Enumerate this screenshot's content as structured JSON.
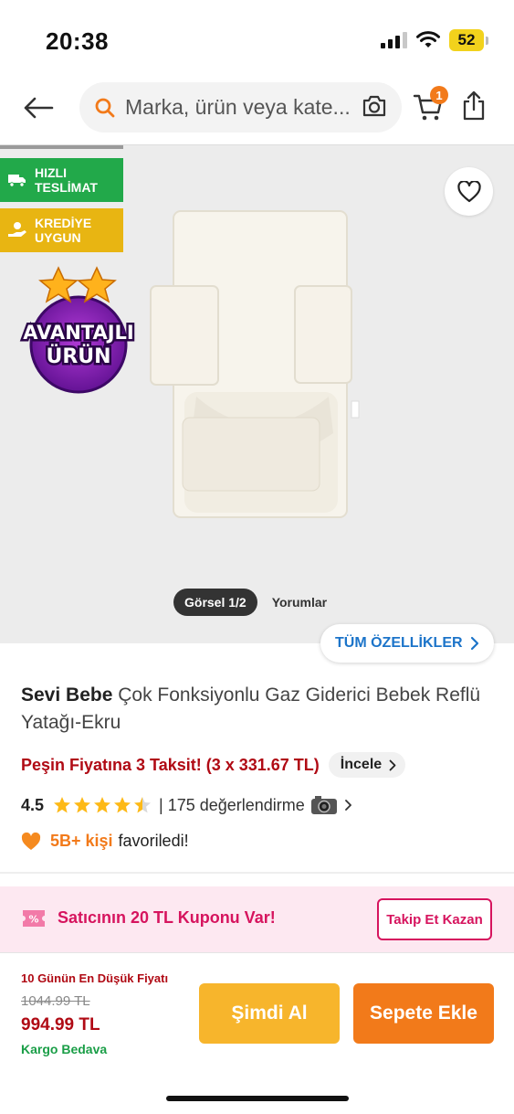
{
  "status_bar": {
    "time": "20:38",
    "battery": "52"
  },
  "search": {
    "placeholder": "Marka, ürün veya kate..."
  },
  "cart": {
    "badge": "1"
  },
  "gallery": {
    "tags": [
      {
        "label": "HIZLI TESLİMAT",
        "color": "#22a94a",
        "icon": "truck-icon"
      },
      {
        "label": "KREDİYE UYGUN",
        "color": "#e8b512",
        "icon": "coin-hand-icon"
      }
    ],
    "advantage_badge": {
      "line1": "AVANTAJLI",
      "line2": "ÜRÜN"
    },
    "tabs": {
      "images": "Görsel 1/2",
      "reviews": "Yorumlar"
    },
    "all_features": "TÜM ÖZELLİKLER"
  },
  "product": {
    "brand": "Sevi Bebe",
    "name": "Çok Fonksiyonlu Gaz Giderici Bebek Reflü Yatağı-Ekru",
    "installment": "Peşin Fiyatına 3 Taksit! (3 x 331.67 TL)",
    "inspect": "İncele",
    "rating": "4.5",
    "rating_stars": 4.5,
    "reviews": "| 175 değerlendirme",
    "favorites_count": "5B+ kişi",
    "favorites_text": "favoriledi!"
  },
  "coupon": {
    "text": "Satıcının 20 TL Kuponu Var!",
    "button": "Takip Et Kazan"
  },
  "purchase": {
    "lowest_label": "10 Günün En Düşük Fiyatı",
    "old_price": "1044.99 TL",
    "price": "994.99 TL",
    "shipping": "Kargo Bedava",
    "buy_now": "Şimdi Al",
    "add_to_cart": "Sepete Ekle"
  },
  "colors": {
    "accent": "#f27a1a",
    "price_red": "#b00a14",
    "buy_now": "#f7b52c",
    "coupon_pink": "#d6145e",
    "link_blue": "#1c74c9"
  }
}
